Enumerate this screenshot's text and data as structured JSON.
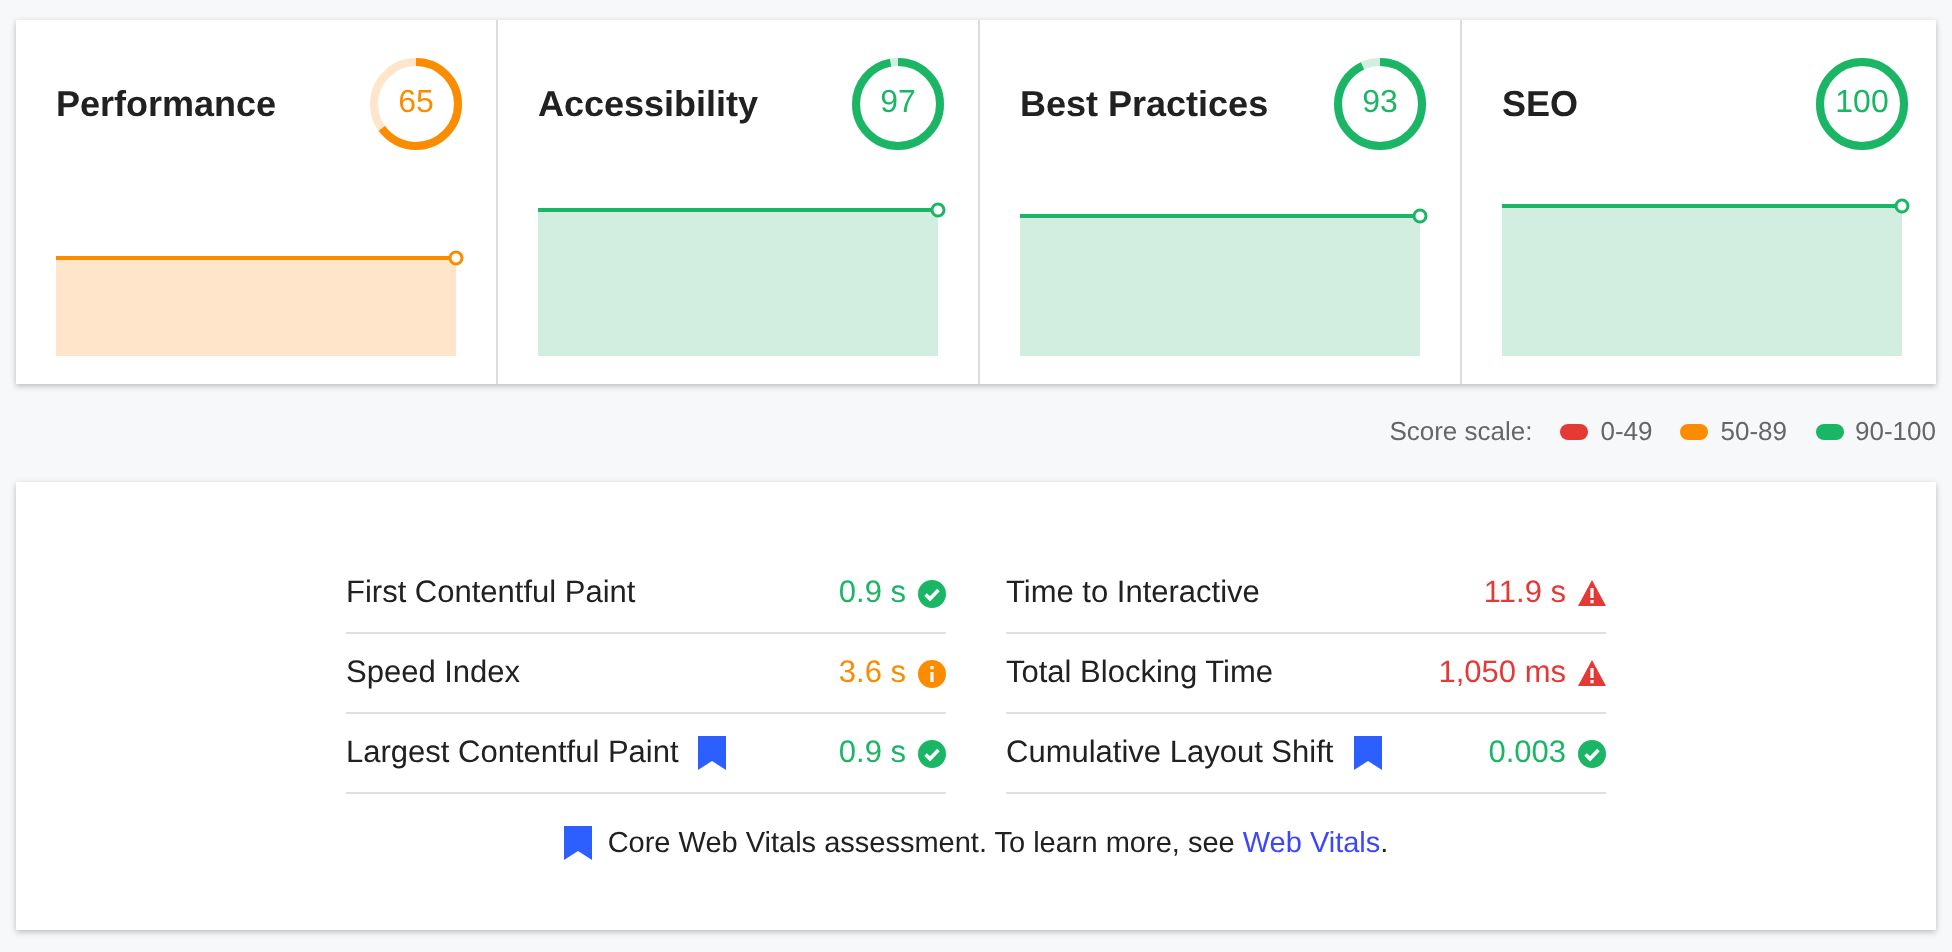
{
  "categories": [
    {
      "title": "Performance",
      "score": "65",
      "kind": "average"
    },
    {
      "title": "Accessibility",
      "score": "97",
      "kind": "pass"
    },
    {
      "title": "Best Practices",
      "score": "93",
      "kind": "pass"
    },
    {
      "title": "SEO",
      "score": "100",
      "kind": "pass"
    }
  ],
  "score_scale": {
    "label": "Score scale:",
    "items": [
      {
        "label": "0-49",
        "color": "#e53935"
      },
      {
        "label": "50-89",
        "color": "#fb8c00"
      },
      {
        "label": "90-100",
        "color": "#1bb566"
      }
    ]
  },
  "metrics": [
    {
      "name": "First Contentful Paint",
      "value": "0.9 s",
      "kind": "pass",
      "core_web_vital": false
    },
    {
      "name": "Time to Interactive",
      "value": "11.9 s",
      "kind": "fail",
      "core_web_vital": false
    },
    {
      "name": "Speed Index",
      "value": "3.6 s",
      "kind": "average",
      "core_web_vital": false
    },
    {
      "name": "Total Blocking Time",
      "value": "1,050 ms",
      "kind": "fail",
      "core_web_vital": false
    },
    {
      "name": "Largest Contentful Paint",
      "value": "0.9 s",
      "kind": "pass",
      "core_web_vital": true
    },
    {
      "name": "Cumulative Layout Shift",
      "value": "0.003",
      "kind": "pass",
      "core_web_vital": true
    }
  ],
  "footnote": {
    "text": "Core Web Vitals assessment. To learn more, see",
    "link": "Web Vitals",
    "end": "."
  }
}
